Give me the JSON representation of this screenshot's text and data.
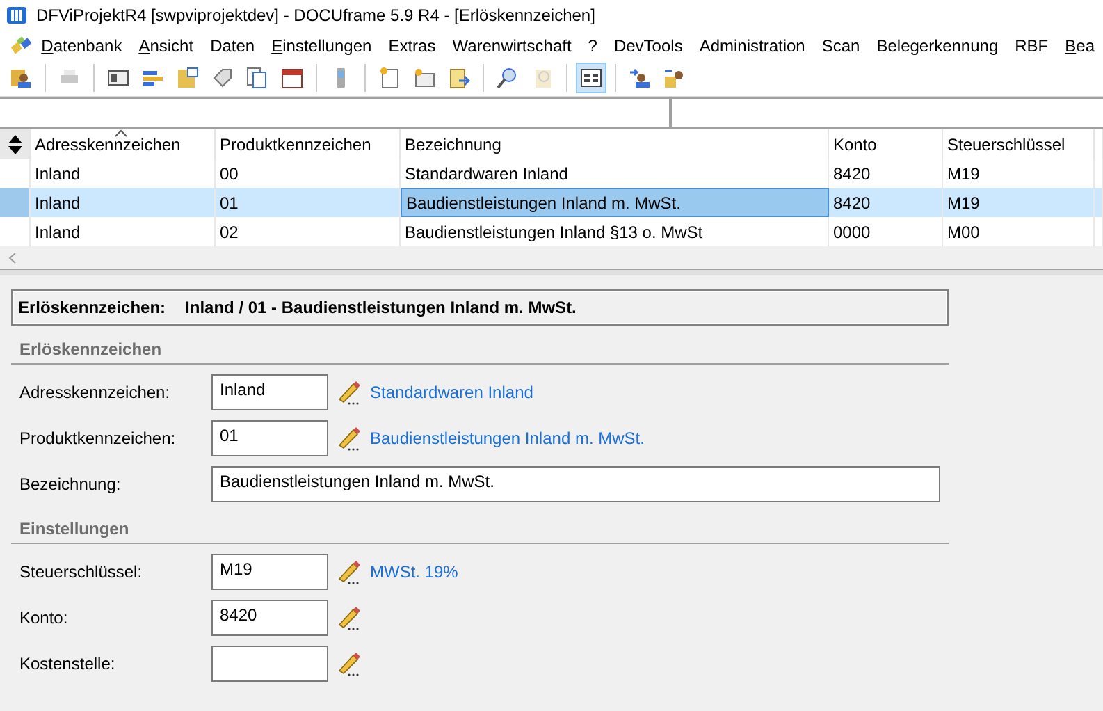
{
  "window": {
    "title": "DFViProjektR4 [swpviprojektdev] - DOCUframe 5.9 R4 - [Erlöskennzeichen]"
  },
  "menu": [
    {
      "label": "Datenbank",
      "underlined": true
    },
    {
      "label": "Ansicht",
      "underlined": true
    },
    {
      "label": "Daten",
      "underlined": false
    },
    {
      "label": "Einstellungen",
      "underlined": true
    },
    {
      "label": "Extras",
      "underlined": false
    },
    {
      "label": "Warenwirtschaft",
      "underlined": false
    },
    {
      "label": "?",
      "underlined": false
    },
    {
      "label": "DevTools",
      "underlined": false
    },
    {
      "label": "Administration",
      "underlined": false
    },
    {
      "label": "Scan",
      "underlined": false
    },
    {
      "label": "Belegerkennung",
      "underlined": false
    },
    {
      "label": "RBF",
      "underlined": false
    },
    {
      "label": "Bea",
      "underlined": true
    }
  ],
  "table": {
    "columns": [
      {
        "label": "Adresskennzeichen",
        "sorted": true
      },
      {
        "label": "Produktkennzeichen",
        "sorted": false
      },
      {
        "label": "Bezeichnung",
        "sorted": false
      },
      {
        "label": "Konto",
        "sorted": false
      },
      {
        "label": "Steuerschlüssel",
        "sorted": false
      }
    ],
    "rows": [
      {
        "selected": false,
        "cells": [
          {
            "text": "Inland",
            "focused": false
          },
          {
            "text": "00",
            "focused": false
          },
          {
            "text": "Standardwaren Inland",
            "focused": false
          },
          {
            "text": "8420",
            "focused": false
          },
          {
            "text": "M19",
            "focused": false
          }
        ]
      },
      {
        "selected": true,
        "cells": [
          {
            "text": "Inland",
            "focused": false
          },
          {
            "text": "01",
            "focused": false
          },
          {
            "text": "Baudienstleistungen Inland m. MwSt.",
            "focused": true
          },
          {
            "text": "8420",
            "focused": false
          },
          {
            "text": "M19",
            "focused": false
          }
        ]
      },
      {
        "selected": false,
        "cells": [
          {
            "text": "Inland",
            "focused": false
          },
          {
            "text": "02",
            "focused": false
          },
          {
            "text": "Baudienstleistungen Inland §13 o. MwSt",
            "focused": false
          },
          {
            "text": "0000",
            "focused": false
          },
          {
            "text": "M00",
            "focused": false
          }
        ]
      }
    ]
  },
  "detail": {
    "header_label": "Erlöskennzeichen:",
    "header_value": "Inland / 01 - Baudienstleistungen Inland m. MwSt.",
    "sections": [
      {
        "title": "Erlöskennzeichen",
        "fields": [
          {
            "label": "Adresskennzeichen:",
            "value": "Inland",
            "kind": "lookup",
            "link": "Standardwaren Inland"
          },
          {
            "label": "Produktkennzeichen:",
            "value": "01",
            "kind": "lookup",
            "link": "Baudienstleistungen Inland m. MwSt."
          },
          {
            "label": "Bezeichnung:",
            "value": "Baudienstleistungen Inland m. MwSt.",
            "kind": "text"
          }
        ]
      },
      {
        "title": "Einstellungen",
        "fields": [
          {
            "label": "Steuerschlüssel:",
            "value": "M19",
            "kind": "lookup",
            "link": "MWSt. 19%"
          },
          {
            "label": "Konto:",
            "value": "8420",
            "kind": "lookup"
          },
          {
            "label": "Kostenstelle:",
            "kind": "lookup"
          }
        ]
      }
    ]
  }
}
